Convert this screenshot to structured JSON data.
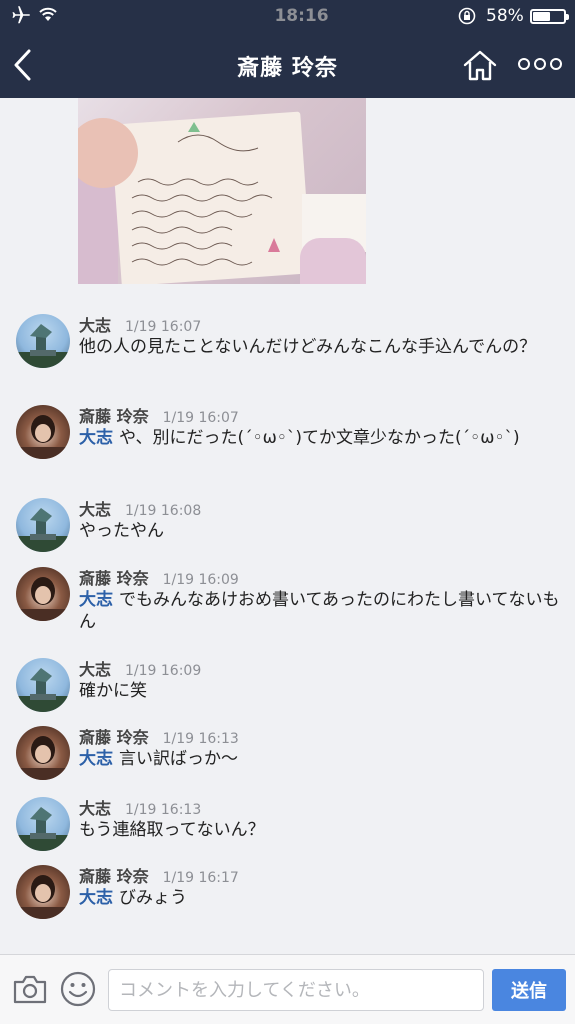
{
  "status_bar": {
    "time": "18:16",
    "battery_pct": "58%",
    "battery_level": 0.58
  },
  "header": {
    "title": "斎藤 玲奈"
  },
  "comments": [
    {
      "author": "大志",
      "time": "1/19 16:07",
      "mention": "",
      "text": "他の人の見たことないんだけどみんなこんな手込んでんの？",
      "avatar": "daishi"
    },
    {
      "author": "斎藤 玲奈",
      "time": "1/19 16:07",
      "mention": "大志",
      "text": "や、別にだった(´◦ω◦`)てか文章少なかった(´◦ω◦`)",
      "avatar": "reina"
    },
    {
      "author": "大志",
      "time": "1/19 16:08",
      "mention": "",
      "text": "やったやん",
      "avatar": "daishi"
    },
    {
      "author": "斎藤 玲奈",
      "time": "1/19 16:09",
      "mention": "大志",
      "text": "でもみんなあけおめ書いてあったのにわたし書いてないもん",
      "avatar": "reina"
    },
    {
      "author": "大志",
      "time": "1/19 16:09",
      "mention": "",
      "text": "確かに笑",
      "avatar": "daishi"
    },
    {
      "author": "斎藤 玲奈",
      "time": "1/19 16:13",
      "mention": "大志",
      "text": "言い訳ばっか〜",
      "avatar": "reina"
    },
    {
      "author": "大志",
      "time": "1/19 16:13",
      "mention": "",
      "text": "もう連絡取ってないん？",
      "avatar": "daishi"
    },
    {
      "author": "斎藤 玲奈",
      "time": "1/19 16:17",
      "mention": "大志",
      "text": "びみょう",
      "avatar": "reina"
    }
  ],
  "input": {
    "placeholder": "コメントを入力してください。",
    "value": ""
  },
  "send_label": "送信",
  "colors": {
    "header_bg": "#263047",
    "mention": "#2c60a8",
    "send_button": "#4a86e0"
  }
}
